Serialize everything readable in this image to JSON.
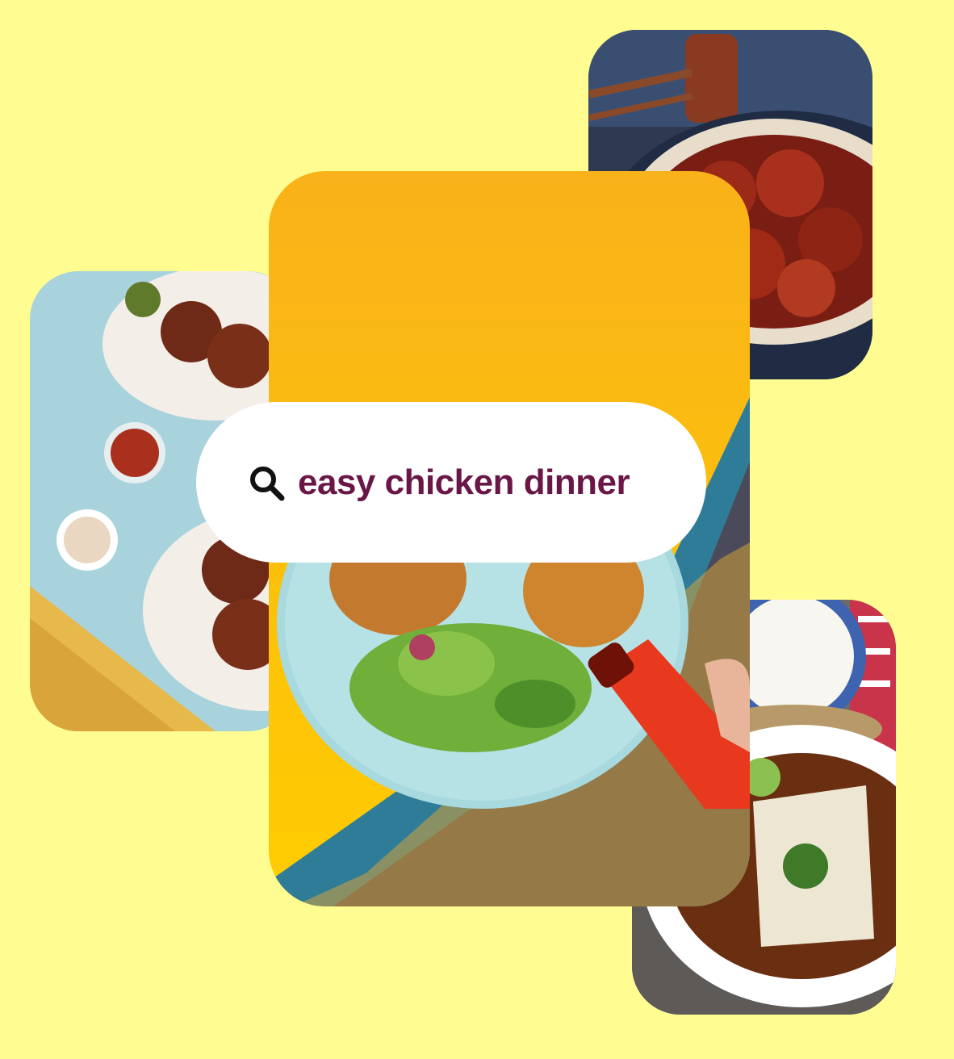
{
  "search": {
    "query": "easy chicken dinner",
    "icon": "search-icon"
  },
  "colors": {
    "background": "#FFFD92",
    "query_text": "#6A1646",
    "pill": "#FFFFFF"
  },
  "cards": [
    {
      "id": "top-right",
      "subject": "glazed-chicken-bowl-photo"
    },
    {
      "id": "left",
      "subject": "chicken-wings-table-photo"
    },
    {
      "id": "center",
      "subject": "fried-chicken-salad-photo"
    },
    {
      "id": "bottom-right",
      "subject": "poached-chicken-rice-photo"
    }
  ]
}
